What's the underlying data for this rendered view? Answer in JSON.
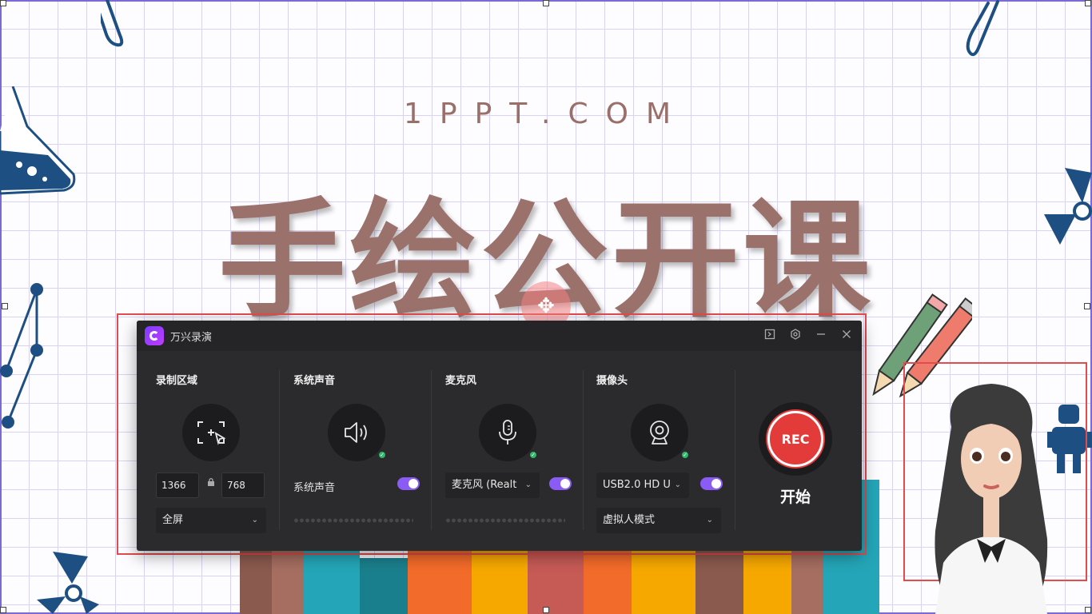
{
  "slide": {
    "site": "1PPT.COM",
    "title": "手绘公开课"
  },
  "recorder": {
    "app_name": "万兴录演",
    "window_controls": [
      "collapse-icon",
      "settings-icon",
      "minimize-icon",
      "close-icon"
    ],
    "record_area": {
      "title": "录制区域",
      "width": "1366",
      "height": "768",
      "mode": "全屏"
    },
    "system_audio": {
      "title": "系统声音",
      "toggle_label": "系统声音",
      "enabled": true
    },
    "microphone": {
      "title": "麦克风",
      "device": "麦克风 (Realt",
      "enabled": true
    },
    "camera": {
      "title": "摄像头",
      "device": "USB2.0 HD U",
      "enabled": true,
      "mode": "虚拟人模式"
    },
    "rec": {
      "button_label": "REC",
      "start_label": "开始"
    }
  },
  "colors": {
    "accent": "#8a5cf5",
    "rec": "#e33a3a",
    "title_text": "#9b726b",
    "ok": "#2fb86a"
  }
}
